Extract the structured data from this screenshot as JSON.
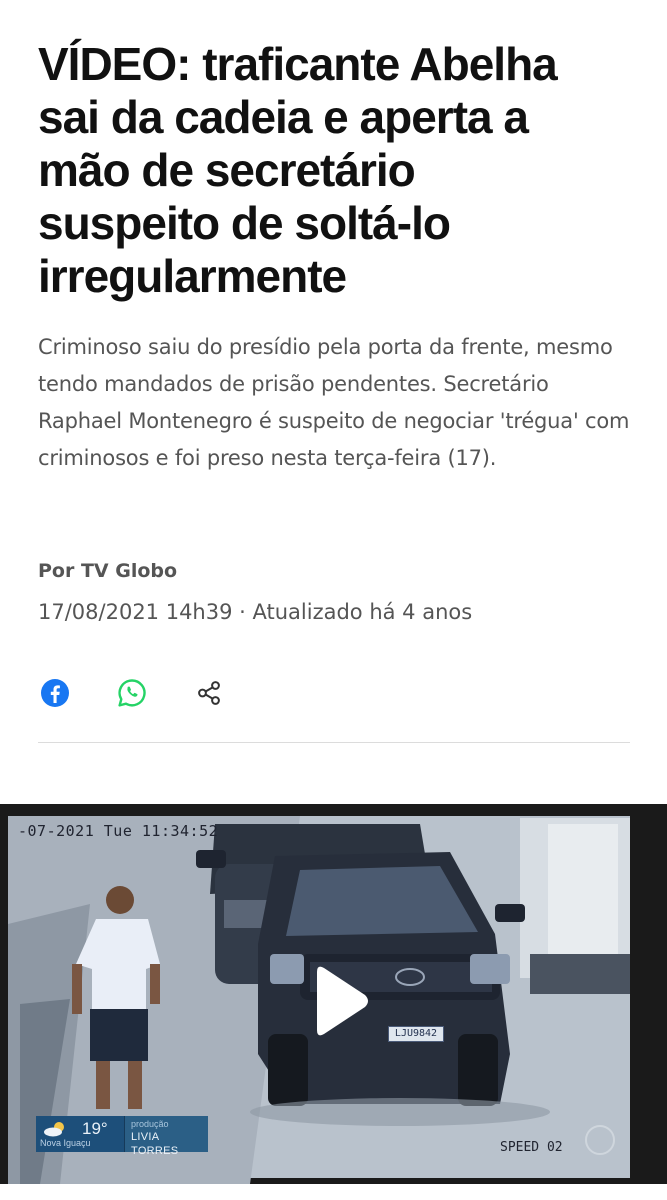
{
  "article": {
    "headline": "VÍDEO: traficante Abelha\nsai da cadeia e aperta a\nmão de secretário\nsuspeito de soltá-lo\nirregularmente",
    "subtitle": "Criminoso saiu do presídio pela porta da frente, mesmo tendo mandados de prisão pendentes. Secretário Raphael Montenegro é suspeito de negociar 'trégua' com criminosos e foi preso nesta terça-feira (17).",
    "byline": "Por TV Globo",
    "dateline": "17/08/2021 14h39 · Atualizado há 4 anos"
  },
  "share": {
    "icons": [
      "facebook-icon",
      "whatsapp-icon",
      "share-icon"
    ],
    "colors": {
      "facebook": "#1877F2",
      "whatsapp": "#25D366",
      "share": "#333333"
    }
  },
  "video": {
    "timestamp": "-07-2021 Tue 11:34:52",
    "speed_label": "SPEED 02",
    "plate": "LJU9842",
    "weather_temp": "19°",
    "weather_location": "Nova Iguaçu",
    "credit_role": "produção",
    "credit_name": "LIVIA TORRES",
    "play_icon": "play-icon"
  }
}
